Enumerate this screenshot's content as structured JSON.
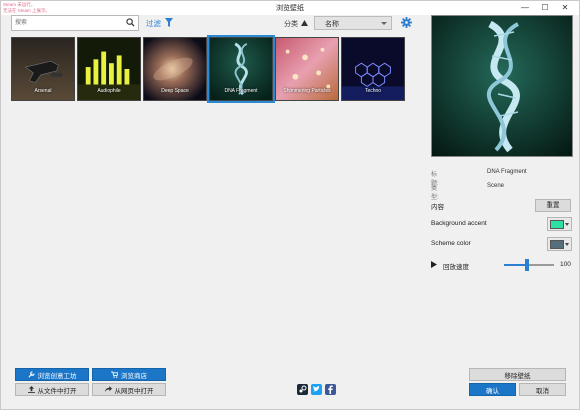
{
  "window": {
    "title": "浏览壁纸",
    "steam_notice_line1": "Steam 未运行。",
    "steam_notice_line2": "无法在 Steam 上展示。",
    "minimize": "—",
    "maximize": "☐",
    "close": "✕"
  },
  "toolbar": {
    "search_placeholder": "搜索",
    "filter_label": "过滤",
    "sort_label": "分类",
    "sort_value": "名称"
  },
  "wallpapers": [
    {
      "name": "Arsenal",
      "selected": false
    },
    {
      "name": "Audiophile",
      "selected": false
    },
    {
      "name": "Deep Space",
      "selected": false
    },
    {
      "name": "DNA Fragment",
      "selected": true
    },
    {
      "name": "Shimmering Particles",
      "selected": false
    },
    {
      "name": "Techno",
      "selected": false
    }
  ],
  "details": {
    "title_key": "标题:",
    "title_value": "DNA Fragment",
    "type_key": "类型:",
    "type_value": "Scene",
    "content_label": "内容",
    "reset_label": "重置",
    "background_accent_label": "Background accent",
    "background_accent_color": "#2ee0a0",
    "scheme_color_label": "Scheme color",
    "scheme_color": "#566d7c",
    "speed_label": "回放速度",
    "speed_value": "100",
    "speed_fraction": 0.45
  },
  "bottom": {
    "workshop_label": "浏览创意工坊",
    "store_label": "浏览商店",
    "open_file_label": "从文件中打开",
    "open_web_label": "从网页中打开",
    "remove_label": "移除壁纸",
    "ok_label": "确认",
    "cancel_label": "取消"
  },
  "colors": {
    "accent": "#1c76c8",
    "filter_text": "#2a7fd0"
  }
}
